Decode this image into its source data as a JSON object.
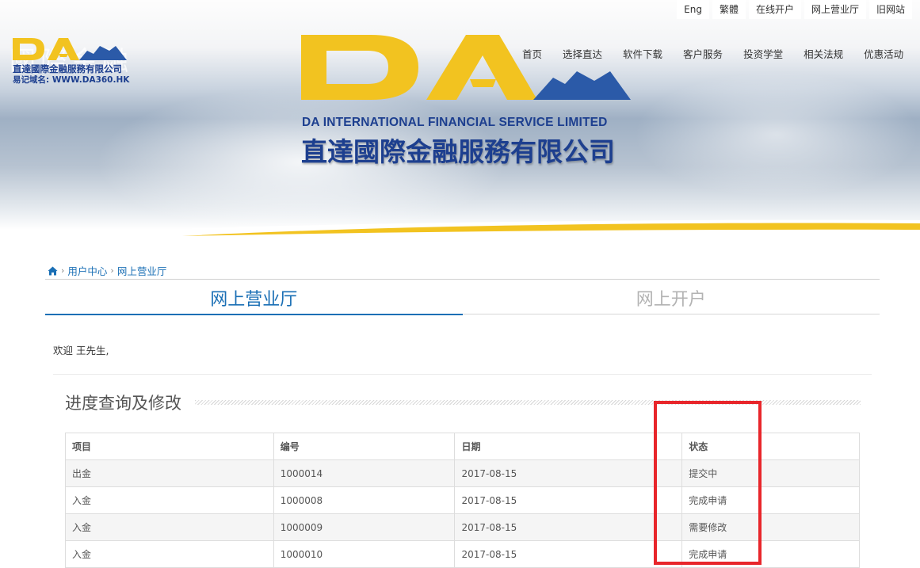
{
  "header": {
    "utility_links": [
      "Eng",
      "繁體",
      "在线开户",
      "网上营业厅",
      "旧网站"
    ],
    "nav_items": [
      "首页",
      "选择直达",
      "软件下载",
      "客户服务",
      "投资学堂",
      "相关法规",
      "优惠活动"
    ],
    "logo": {
      "mark": "DA",
      "ghost_text": "國際金融",
      "company_cn": "直達國際金融服務有限公司",
      "domain": "易记域名: WWW.DA360.HK"
    },
    "banner": {
      "mark": "DA",
      "company_en": "DA INTERNATIONAL FINANCIAL SERVICE LIMITED",
      "company_cn": "直達國際金融服務有限公司"
    }
  },
  "breadcrumb": {
    "items": [
      "用户中心",
      "网上营业厅"
    ],
    "separator": "›",
    "home_icon": "home-icon"
  },
  "tabs": [
    {
      "label": "网上营业厅",
      "active": true
    },
    {
      "label": "网上开户",
      "active": false
    }
  ],
  "welcome": "欢迎 王先生,",
  "section": {
    "title": "进度查询及修改"
  },
  "table": {
    "headers": [
      "项目",
      "编号",
      "日期",
      "状态"
    ],
    "rows": [
      {
        "item": "出金",
        "number": "1000014",
        "date": "2017-08-15",
        "status": "提交中",
        "status_type": "pending"
      },
      {
        "item": "入金",
        "number": "1000008",
        "date": "2017-08-15",
        "status": "完成申请",
        "status_type": "link"
      },
      {
        "item": "入金",
        "number": "1000009",
        "date": "2017-08-15",
        "status": "需要修改",
        "status_type": "alert"
      },
      {
        "item": "入金",
        "number": "1000010",
        "date": "2017-08-15",
        "status": "完成申请",
        "status_type": "link"
      }
    ]
  },
  "colors": {
    "accent_blue": "#1a6fb5",
    "brand_yellow": "#f2c320",
    "brand_navy": "#1d3f8f",
    "alert_red": "#d9342b",
    "highlight_red": "#e8262b"
  }
}
